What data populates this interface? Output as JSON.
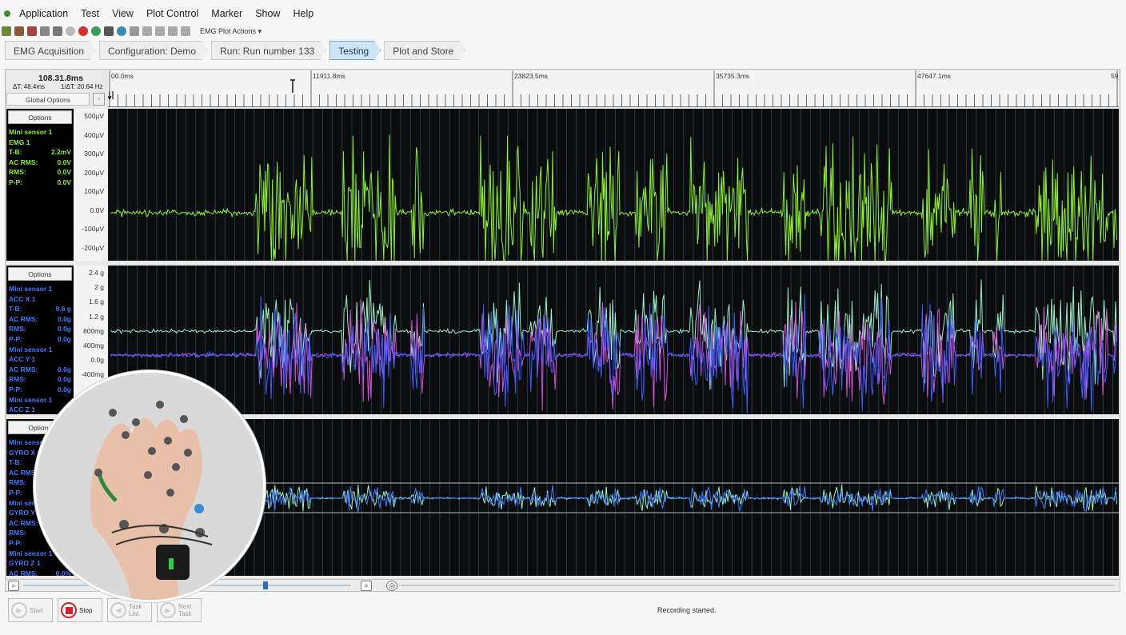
{
  "menu": [
    "Application",
    "Test",
    "View",
    "Plot Control",
    "Marker",
    "Show",
    "Help"
  ],
  "toolbar": {
    "plot_actions": "EMG Plot Actions"
  },
  "steps": [
    {
      "label": "EMG Acquisition",
      "active": false
    },
    {
      "label": "Configuration: Demo",
      "active": false
    },
    {
      "label": "Run: Run number 133",
      "active": false
    },
    {
      "label": "Testing",
      "active": true
    },
    {
      "label": "Plot and Store",
      "active": false
    }
  ],
  "time": {
    "cursor": "108.31.8ms",
    "delta": "ΔT: 48.4ms",
    "freq": "1/ΔT: 20.64 Hz",
    "global_options": "Global Options"
  },
  "ruler": {
    "ticks": [
      "00.0ms",
      "11911.8ms",
      "23823.5ms",
      "35735.3ms",
      "47647.1ms",
      "59"
    ]
  },
  "panels": {
    "emg": {
      "options": "Options",
      "color": "#8ef02e",
      "rows": [
        [
          "Mini sensor 1",
          ""
        ],
        [
          "EMG 1",
          ""
        ],
        [
          "T-B:",
          "2.2mV"
        ],
        [
          "AC RMS:",
          "0.0V"
        ],
        [
          "RMS:",
          "0.0V"
        ],
        [
          "P-P:",
          "0.0V"
        ]
      ],
      "yticks": [
        "500µV",
        "400µV",
        "300µV",
        "200µV",
        "100µV",
        "0.0V",
        "-100µV",
        "-200µV"
      ]
    },
    "acc": {
      "options": "Options",
      "color": "#3d7bff",
      "rows": [
        [
          "Mini sensor 1",
          ""
        ],
        [
          "ACC X 1",
          ""
        ],
        [
          "T-B:",
          "9.6 g"
        ],
        [
          "AC RMS:",
          "0.0g"
        ],
        [
          "RMS:",
          "0.0g"
        ],
        [
          "P-P:",
          "0.0g"
        ],
        [
          "Mini sensor 1",
          ""
        ],
        [
          "ACC Y 1",
          ""
        ],
        [
          "AC RMS:",
          "0.0g"
        ],
        [
          "RMS:",
          "0.0g"
        ],
        [
          "P-P:",
          "0.0g"
        ],
        [
          "Mini sensor 1",
          ""
        ],
        [
          "ACC Z 1",
          ""
        ]
      ],
      "yticks": [
        "2.4 g",
        "2 g",
        "1.6 g",
        "1.2 g",
        "800mg",
        "400mg",
        "0.0g",
        "-400mg"
      ]
    },
    "gyro": {
      "options": "Options",
      "color": "#3d7bff",
      "rows": [
        [
          "Mini sensor 1",
          ""
        ],
        [
          "GYRO X 1",
          ""
        ],
        [
          "T-B:",
          ""
        ],
        [
          "AC RMS:",
          ""
        ],
        [
          "RMS:",
          ""
        ],
        [
          "P-P:",
          ""
        ],
        [
          "Mini sensor 1",
          ""
        ],
        [
          "GYRO Y 1",
          ""
        ],
        [
          "AC RMS:",
          ""
        ],
        [
          "RMS:",
          ""
        ],
        [
          "P-P:",
          ""
        ],
        [
          "Mini sensor 1",
          ""
        ],
        [
          "GYRO Z 1",
          ""
        ],
        [
          "AC RMS:",
          "0.0%"
        ]
      ]
    }
  },
  "buttons": {
    "start": "Start",
    "stop": "Stop",
    "task_list": "Task List",
    "next_task": "Next Task"
  },
  "status": "Recording started."
}
